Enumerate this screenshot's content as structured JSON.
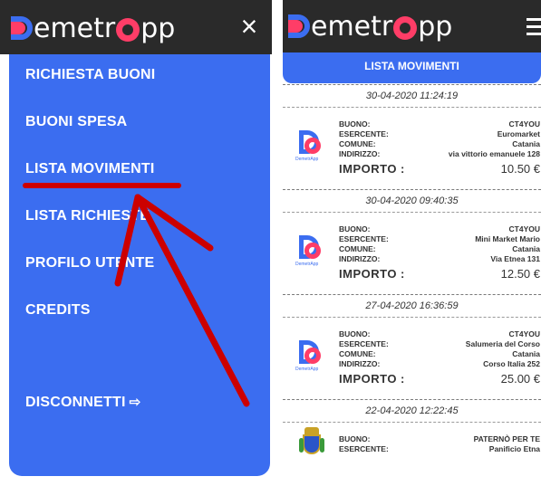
{
  "app": {
    "name_left": "emetr",
    "name_right": "pp",
    "colors": {
      "primary": "#3b6df0",
      "accent": "#ff3d67",
      "header": "#2a2a2a",
      "annotation": "#cc0000"
    }
  },
  "left_panel": {
    "close_icon": "×",
    "menu": [
      {
        "label": "RICHIESTA BUONI"
      },
      {
        "label": "BUONI SPESA"
      },
      {
        "label": "LISTA MOVIMENTI"
      },
      {
        "label": "LISTA RICHIESTE"
      },
      {
        "label": "PROFILO UTENTE"
      },
      {
        "label": "CREDITS"
      },
      {
        "label": "DISCONNETTI",
        "icon": "⇨"
      }
    ]
  },
  "right_panel": {
    "tab_title": "LISTA MOVIMENTI",
    "labels": {
      "buono": "BUONO:",
      "esercente": "ESERCENTE:",
      "comune": "COMUNE:",
      "indirizzo": "INDIRIZZO:",
      "importo": "IMPORTO :"
    },
    "logo_caption": "DemetrApp",
    "entries": [
      {
        "datetime": "30-04-2020 11:24:19",
        "buono": "CT4YOU",
        "esercente": "Euromarket",
        "comune": "Catania",
        "indirizzo": "via vittorio emanuele 128",
        "importo": "10.50 €"
      },
      {
        "datetime": "30-04-2020 09:40:35",
        "buono": "CT4YOU",
        "esercente": "Mini Market Mario",
        "comune": "Catania",
        "indirizzo": "Via Etnea 131",
        "importo": "12.50 €"
      },
      {
        "datetime": "27-04-2020 16:36:59",
        "buono": "CT4YOU",
        "esercente": "Salumeria del Corso",
        "comune": "Catania",
        "indirizzo": "Corso Italia 252",
        "importo": "25.00 €"
      },
      {
        "datetime": "22-04-2020 12:22:45",
        "buono": "PATERNÒ PER TE",
        "esercente": "Panificio Etna"
      }
    ]
  }
}
